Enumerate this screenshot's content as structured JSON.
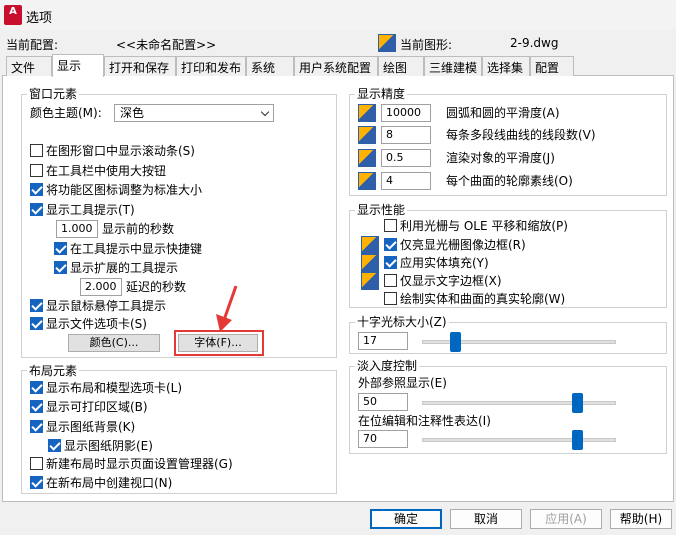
{
  "window": {
    "title": "选项",
    "app_icon_text": "A"
  },
  "header": {
    "current_profile_label": "当前配置:",
    "current_profile_value": "<<未命名配置>>",
    "current_drawing_label": "当前图形:",
    "current_drawing_value": "2-9.dwg"
  },
  "tabs": [
    "文件",
    "显示",
    "打开和保存",
    "打印和发布",
    "系统",
    "用户系统配置",
    "绘图",
    "三维建模",
    "选择集",
    "配置"
  ],
  "active_tab": "显示",
  "window_elements": {
    "title": "窗口元素",
    "theme_label": "颜色主题(M):",
    "theme_value": "深色",
    "items": [
      {
        "label": "在图形窗口中显示滚动条(S)",
        "checked": false
      },
      {
        "label": "在工具栏中使用大按钮",
        "checked": false
      },
      {
        "label": "将功能区图标调整为标准大小",
        "checked": true
      },
      {
        "label": "显示工具提示(T)",
        "checked": true
      }
    ],
    "tooltip_delay_value": "1.000",
    "tooltip_delay_label": "显示前的秒数",
    "shortcut_label": "在工具提示中显示快捷键",
    "extended_label": "显示扩展的工具提示",
    "extended_delay_value": "2.000",
    "extended_delay_label": "延迟的秒数",
    "rollover_label": "显示鼠标悬停工具提示",
    "file_tabs_label": "显示文件选项卡(S)",
    "colors_button": "颜色(C)...",
    "fonts_button": "字体(F)..."
  },
  "layout_elements": {
    "title": "布局元素",
    "items": [
      {
        "label": "显示布局和模型选项卡(L)",
        "checked": true
      },
      {
        "label": "显示可打印区域(B)",
        "checked": true
      },
      {
        "label": "显示图纸背景(K)",
        "checked": true
      },
      {
        "label": "显示图纸阴影(E)",
        "checked": true
      },
      {
        "label": "新建布局时显示页面设置管理器(G)",
        "checked": false
      },
      {
        "label": "在新布局中创建视口(N)",
        "checked": true
      }
    ]
  },
  "display_resolution": {
    "title": "显示精度",
    "items": [
      {
        "value": "10000",
        "label": "圆弧和圆的平滑度(A)"
      },
      {
        "value": "8",
        "label": "每条多段线曲线的线段数(V)"
      },
      {
        "value": "0.5",
        "label": "渲染对象的平滑度(J)"
      },
      {
        "value": "4",
        "label": "每个曲面的轮廓素线(O)"
      }
    ]
  },
  "display_performance": {
    "title": "显示性能",
    "items": [
      {
        "label": "利用光栅与 OLE 平移和缩放(P)",
        "checked": false,
        "icon": false
      },
      {
        "label": "仅亮显光栅图像边框(R)",
        "checked": true,
        "icon": true
      },
      {
        "label": "应用实体填充(Y)",
        "checked": true,
        "icon": true
      },
      {
        "label": "仅显示文字边框(X)",
        "checked": false,
        "icon": true
      },
      {
        "label": "绘制实体和曲面的真实轮廓(W)",
        "checked": false,
        "icon": false
      }
    ]
  },
  "crosshair": {
    "title": "十字光标大小(Z)",
    "value": "17",
    "fraction": 0.17
  },
  "fade": {
    "title": "淡入度控制",
    "xref_label": "外部参照显示(E)",
    "xref_value": "50",
    "xref_fraction": 0.8,
    "inplace_label": "在位编辑和注释性表达(I)",
    "inplace_value": "70",
    "inplace_fraction": 0.8
  },
  "buttons": {
    "ok": "确定",
    "cancel": "取消",
    "apply": "应用(A)",
    "help": "帮助(H)"
  },
  "colors": {
    "accent": "#0067c0",
    "checkbox": "#1565c0",
    "annotation": "#e53935",
    "app_icon": "#c8102e"
  }
}
